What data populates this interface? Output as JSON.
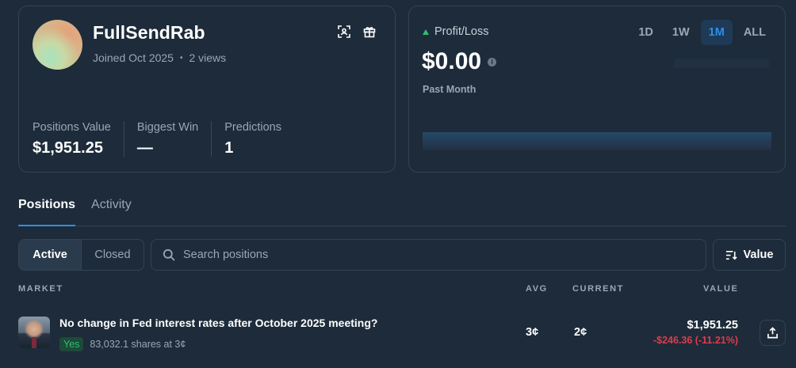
{
  "profile": {
    "username": "FullSendRab",
    "joined": "Joined Oct 2025",
    "views": "2 views",
    "stats": [
      {
        "label": "Positions Value",
        "value": "$1,951.25"
      },
      {
        "label": "Biggest Win",
        "value": "—"
      },
      {
        "label": "Predictions",
        "value": "1"
      }
    ],
    "icons": [
      "scan-icon",
      "gift-icon"
    ]
  },
  "pnl": {
    "label": "Profit/Loss",
    "value": "$0.00",
    "period": "Past Month",
    "ranges": [
      "1D",
      "1W",
      "1M",
      "ALL"
    ],
    "active_range": "1M",
    "colors": {
      "up": "#2fbf71",
      "accent": "#2e8fe6"
    }
  },
  "tabs": [
    {
      "label": "Positions",
      "active": true
    },
    {
      "label": "Activity",
      "active": false
    }
  ],
  "filters": {
    "segments": [
      "Active",
      "Closed"
    ],
    "active_segment": "Active",
    "search_placeholder": "Search positions",
    "sort_label": "Value"
  },
  "table": {
    "headers": {
      "market": "MARKET",
      "avg": "AVG",
      "current": "CURRENT",
      "value": "VALUE"
    },
    "rows": [
      {
        "title": "No change in Fed interest rates after October 2025 meeting?",
        "outcome": "Yes",
        "shares": "83,032.1 shares at 3¢",
        "avg": "3¢",
        "current": "2¢",
        "value": "$1,951.25",
        "change": "-$246.36 (-11.21%)"
      }
    ]
  }
}
